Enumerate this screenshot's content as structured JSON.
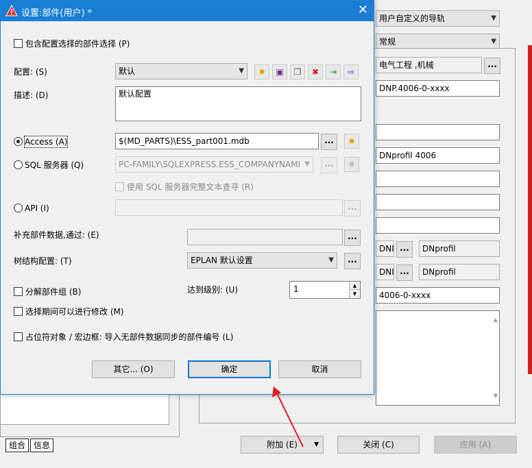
{
  "dialog": {
    "title": "设置:部件(用户) *",
    "include_selection_label": "包含配置选择的部件选择 (P)",
    "config_label": "配置: (S)",
    "config_value": "默认",
    "desc_label": "描述: (D)",
    "desc_value": "默认配置",
    "access_label": "Access (A)",
    "access_value": "$(MD_PARTS)\\ESS_part001.mdb",
    "sql_label": "SQL 服务器 (Q)",
    "sql_value": "PC-FAMILY\\SQLEXPRESS.ESS_COMPANYNAMI",
    "sql_fulltext_label": "使用 SQL 服务器完整文本查寻 (R)",
    "api_label": "API (I)",
    "supplement_label": "补充部件数据,通过: (E)",
    "tree_config_label": "树结构配置: (T)",
    "tree_config_value": "EPLAN 默认设置",
    "decompose_label": "分解部件组 (B)",
    "level_label": "达到级别: (U)",
    "level_value": "1",
    "modify_label": "选择期间可以进行修改 (M)",
    "placeholder_label": "占位符对象 / 宏边框: 导入无部件数据同步的部件编号 (L)",
    "other_button": "其它... (O)",
    "ok_button": "确定",
    "cancel_button": "取消",
    "ellipsis": "..."
  },
  "background": {
    "nav_combo": "用户自定义的导轨",
    "category_combo": "常规",
    "product_group": "电气工程 ,机械",
    "part_number": "DNP.4006-0-xxxx",
    "type_number": "DNprofil 4006",
    "short_field_1": "DNI",
    "long_field_1": "DNprofil",
    "short_field_2": "DNI",
    "long_field_2": "DNprofil",
    "order_number": "4006-0-xxxx",
    "tab_combo": "组合",
    "tab_info": "信息",
    "add_button": "附加 (E)",
    "close_button": "关闭 (C)",
    "apply_button": "应用 (A)"
  },
  "colors": {
    "title_bar": "#1a7fd4",
    "annotation_arrow": "#e02020"
  }
}
